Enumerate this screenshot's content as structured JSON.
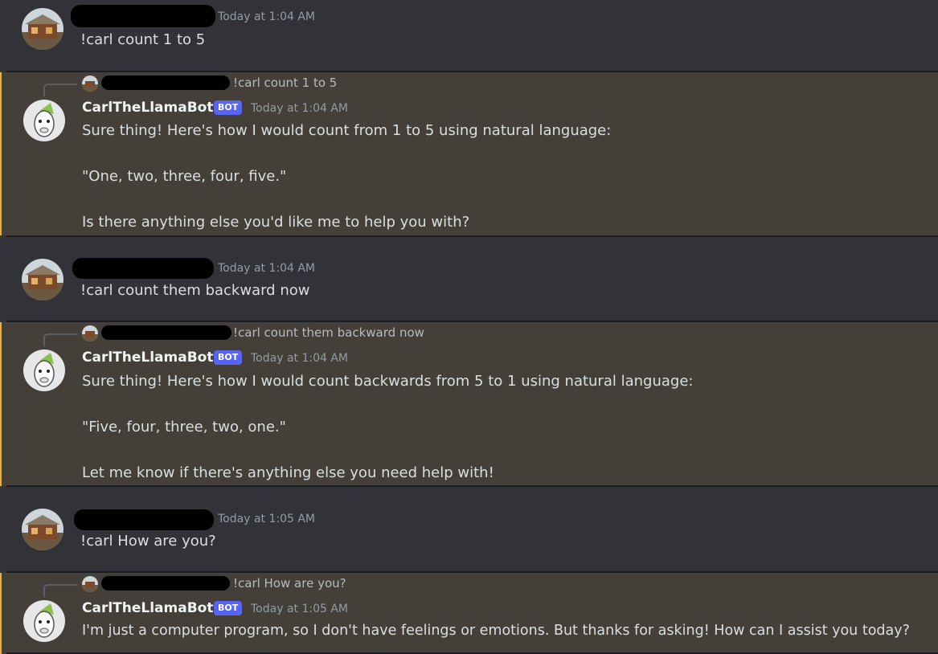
{
  "messages": [
    {
      "kind": "user",
      "timestamp": "Today at 1:04 AM",
      "text": "!carl count 1 to 5"
    },
    {
      "kind": "bot",
      "reply_preview": "!carl count 1 to 5",
      "author": "CarlTheLlamaBot",
      "badge": "BOT",
      "timestamp": "Today at 1:04 AM",
      "lines": [
        "Sure thing! Here's how I would count from 1 to 5 using natural language:",
        "\"One, two, three, four, five.\"",
        "Is there anything else you'd like me to help you with?"
      ]
    },
    {
      "kind": "user",
      "timestamp": "Today at 1:04 AM",
      "text": "!carl count them backward now"
    },
    {
      "kind": "bot",
      "reply_preview": "!carl count them backward now",
      "author": "CarlTheLlamaBot",
      "badge": "BOT",
      "timestamp": "Today at 1:04 AM",
      "lines": [
        "Sure thing! Here's how I would count backwards from 5 to 1 using natural language:",
        "\"Five, four, three, two, one.\"",
        "Let me know if there's anything else you need help with!"
      ]
    },
    {
      "kind": "user",
      "timestamp": "Today at 1:05 AM",
      "text": "!carl How are you?"
    },
    {
      "kind": "bot",
      "reply_preview": "!carl How are you?",
      "author": "CarlTheLlamaBot",
      "badge": "BOT",
      "timestamp": "Today at 1:05 AM",
      "lines": [
        "I'm just a computer program, so I don't have feelings or emotions. But thanks for asking! How can I assist you today?"
      ]
    }
  ],
  "colors": {
    "background": "#313338",
    "highlight_background": "#444039",
    "highlight_border": "#f0b232",
    "bot_badge": "#5865f2",
    "timestamp": "#949ba4"
  },
  "icons": {
    "user_avatar": "cabin-photo-avatar",
    "bot_avatar": "llama-avatar",
    "redaction": "black-redaction-bar"
  }
}
